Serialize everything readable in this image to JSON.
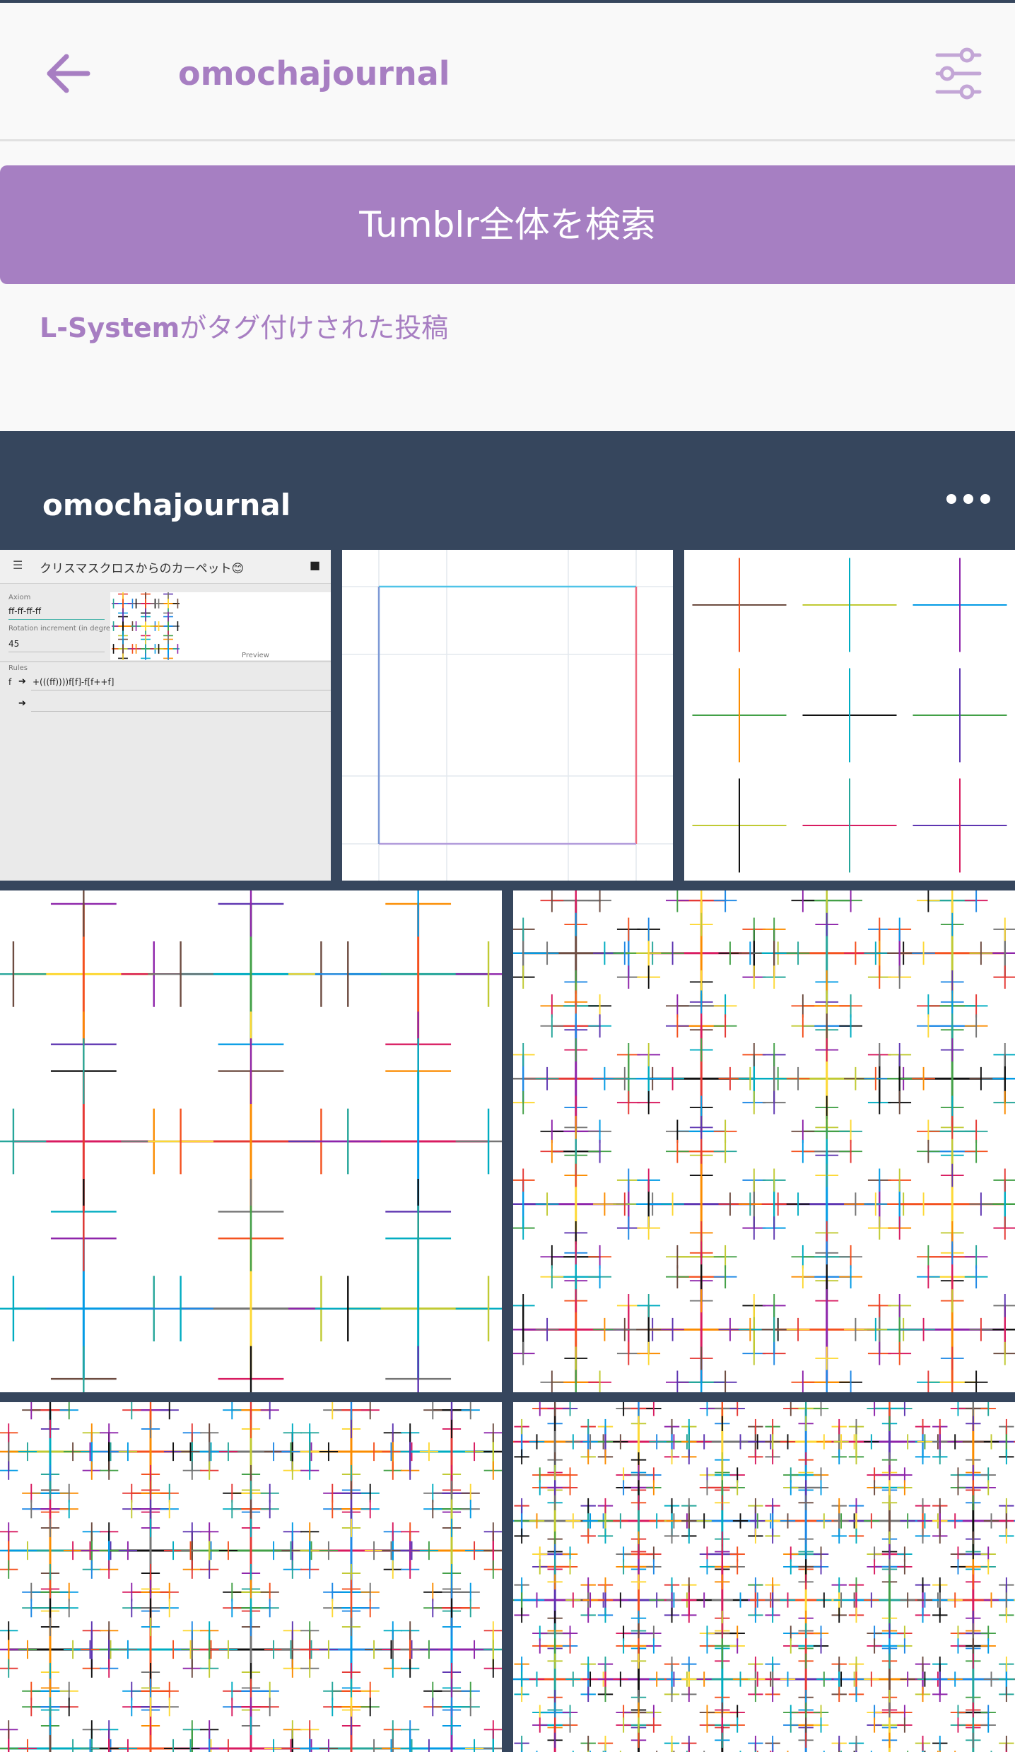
{
  "header": {
    "title": "omochajournal",
    "back_icon": "arrow-left-icon",
    "filter_icon": "sliders-icon",
    "accent_color": "#a77ec2"
  },
  "search": {
    "label": "Tumblr全体を検索",
    "background_color": "#a67fc2"
  },
  "tag_caption": {
    "tag": "L-System",
    "suffix": "がタグ付けされた投稿"
  },
  "post": {
    "blog_name": "omochajournal",
    "more_icon": "more-dots-icon",
    "background_color": "#36465d",
    "app_screenshot": {
      "title": "クリスマスクロスからのカーペット😊",
      "axiom_label": "Axiom",
      "axiom_value": "ff-ff-ff-ff",
      "rotation_label": "Rotation increment (in degrees)",
      "rotation_value": "45",
      "rules_label": "Rules",
      "rule_1_symbol": "f",
      "rule_1_value": "+(((ff))))f[f]-f[f++f]",
      "preview_label": "Preview"
    },
    "images": [
      "app-screenshot",
      "l-system-square",
      "l-system-cross-level-1",
      "l-system-cross-level-2",
      "l-system-cross-level-3",
      "l-system-carpet-level-4",
      "l-system-carpet-level-5"
    ]
  }
}
